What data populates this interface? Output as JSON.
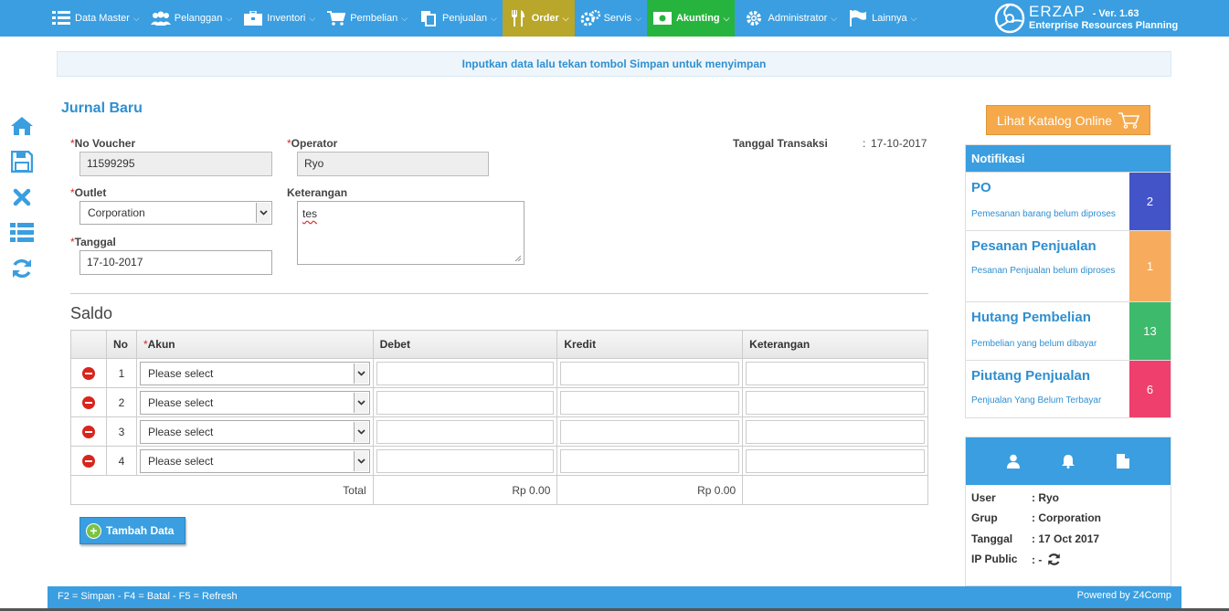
{
  "nav": {
    "items": [
      {
        "label": "Data Master",
        "icon": "list-icon"
      },
      {
        "label": "Pelanggan",
        "icon": "users-icon"
      },
      {
        "label": "Inventori",
        "icon": "briefcase-icon"
      },
      {
        "label": "Pembelian",
        "icon": "cart-icon"
      },
      {
        "label": "Penjualan",
        "icon": "copy-icon"
      },
      {
        "label": "Order",
        "icon": "cutlery-icon"
      },
      {
        "label": "Servis",
        "icon": "gears-icon"
      },
      {
        "label": "Akunting",
        "icon": "money-icon"
      },
      {
        "label": "Administrator",
        "icon": "gear-icon"
      },
      {
        "label": "Lainnya",
        "icon": "flag-icon"
      }
    ],
    "colors": {
      "bar": "#3a9ee0",
      "order": "#b8a72a",
      "akunting": "#27b43e"
    }
  },
  "brand": {
    "name": "ERZAP",
    "version": "- Ver. 1.63",
    "subtitle": "Enterprise Resources Planning"
  },
  "banner": {
    "text": "Inputkan data lalu tekan tombol Simpan untuk menyimpan"
  },
  "form": {
    "title": "Jurnal Baru",
    "no_voucher_label": "No Voucher",
    "no_voucher_value": "11599295",
    "operator_label": "Operator",
    "operator_value": "Ryo",
    "outlet_label": "Outlet",
    "outlet_value": "Corporation",
    "keterangan_label": "Keterangan",
    "keterangan_value": "tes",
    "tanggal_label": "Tanggal",
    "tanggal_value": "17-10-2017",
    "tanggal_transaksi_label": "Tanggal Transaksi",
    "tanggal_transaksi_colon": ":",
    "tanggal_transaksi_value": "17-10-2017",
    "required_mark": "*"
  },
  "saldo": {
    "title": "Saldo",
    "columns": {
      "no": "No",
      "akun": "Akun",
      "debet": "Debet",
      "kredit": "Kredit",
      "keterangan": "Keterangan"
    },
    "rows": [
      {
        "no": "1",
        "akun": "Please select"
      },
      {
        "no": "2",
        "akun": "Please select"
      },
      {
        "no": "3",
        "akun": "Please select"
      },
      {
        "no": "4",
        "akun": "Please select"
      }
    ],
    "total_label": "Total",
    "total_debet": "Rp 0.00",
    "total_kredit": "Rp 0.00"
  },
  "add_button": {
    "label": "Tambah Data"
  },
  "katalog_button": {
    "label": "Lihat Katalog Online"
  },
  "notifikasi": {
    "title": "Notifikasi",
    "items": [
      {
        "title": "PO",
        "desc": "Pemesanan barang belum diproses",
        "count": "2",
        "color": "#4353c8"
      },
      {
        "title": "Pesanan Penjualan",
        "desc": "Pesanan Penjualan belum diproses",
        "count": "1",
        "color": "#f7ab5c"
      },
      {
        "title": "Hutang Pembelian",
        "desc": "Pembelian yang belum dibayar",
        "count": "13",
        "color": "#3dba6b"
      },
      {
        "title": "Piutang Penjualan",
        "desc": "Penjualan Yang Belum Terbayar",
        "count": "6",
        "color": "#ef3f6c"
      }
    ]
  },
  "user": {
    "user_label": "User",
    "user_value": ": Ryo",
    "grup_label": "Grup",
    "grup_value": ": Corporation",
    "tanggal_label": "Tanggal",
    "tanggal_value": ": 17 Oct 2017",
    "ip_label": "IP Public",
    "ip_value": ": -"
  },
  "footer": {
    "shortcuts": "F2 = Simpan - F4 = Batal - F5 = Refresh",
    "powered": "Powered by Z4Comp"
  }
}
